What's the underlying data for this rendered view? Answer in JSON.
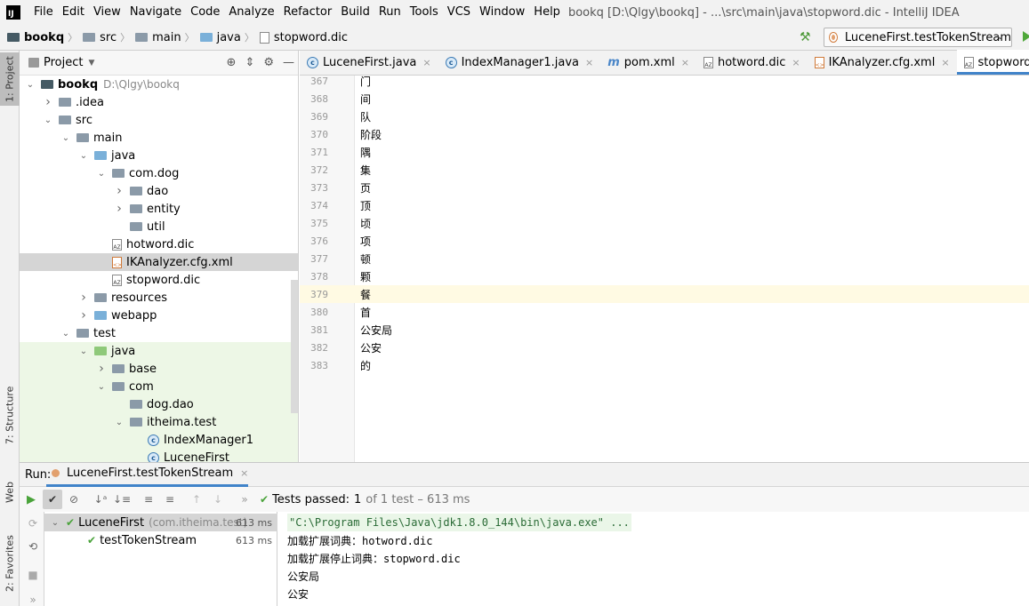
{
  "menubar": {
    "logo_text": "IJ",
    "items": [
      "File",
      "Edit",
      "View",
      "Navigate",
      "Code",
      "Analyze",
      "Refactor",
      "Build",
      "Run",
      "Tools",
      "VCS",
      "Window",
      "Help"
    ],
    "title": "bookq [D:\\Qlgy\\bookq] - ...\\src\\main\\java\\stopword.dic - IntelliJ IDEA"
  },
  "breadcrumb": [
    "bookq",
    "src",
    "main",
    "java",
    "stopword.dic"
  ],
  "run_config": {
    "label": "LuceneFirst.testTokenStream",
    "chevron": "⌄"
  },
  "left_strip": {
    "project": "1: Project",
    "structure": "7: Structure",
    "web": "Web",
    "favorites": "2: Favorites"
  },
  "project_panel": {
    "title": "Project",
    "tree": [
      {
        "label": "bookq",
        "path": "D:\\Qlgy\\bookq",
        "depth": 0,
        "open": true,
        "kind": "folder-dark"
      },
      {
        "label": ".idea",
        "depth": 1,
        "open": false,
        "kind": "folder"
      },
      {
        "label": "src",
        "depth": 1,
        "open": true,
        "kind": "folder"
      },
      {
        "label": "main",
        "depth": 2,
        "open": true,
        "kind": "folder"
      },
      {
        "label": "java",
        "depth": 3,
        "open": true,
        "kind": "folder-blue"
      },
      {
        "label": "com.dog",
        "depth": 4,
        "open": true,
        "kind": "folder"
      },
      {
        "label": "dao",
        "depth": 5,
        "open": false,
        "kind": "folder"
      },
      {
        "label": "entity",
        "depth": 5,
        "open": false,
        "kind": "folder"
      },
      {
        "label": "util",
        "depth": 5,
        "open": null,
        "kind": "folder"
      },
      {
        "label": "hotword.dic",
        "depth": 4,
        "open": null,
        "kind": "file"
      },
      {
        "label": "IKAnalyzer.cfg.xml",
        "depth": 4,
        "open": null,
        "kind": "xml",
        "selected": true
      },
      {
        "label": "stopword.dic",
        "depth": 4,
        "open": null,
        "kind": "file"
      },
      {
        "label": "resources",
        "depth": 3,
        "open": false,
        "kind": "folder"
      },
      {
        "label": "webapp",
        "depth": 3,
        "open": false,
        "kind": "folder-blue"
      },
      {
        "label": "test",
        "depth": 2,
        "open": true,
        "kind": "folder"
      },
      {
        "label": "java",
        "depth": 3,
        "open": true,
        "kind": "folder-green",
        "green": true
      },
      {
        "label": "base",
        "depth": 4,
        "open": false,
        "kind": "folder",
        "green": true
      },
      {
        "label": "com",
        "depth": 4,
        "open": true,
        "kind": "folder",
        "green": true
      },
      {
        "label": "dog.dao",
        "depth": 5,
        "open": null,
        "kind": "folder",
        "green": true
      },
      {
        "label": "itheima.test",
        "depth": 5,
        "open": true,
        "kind": "folder",
        "green": true
      },
      {
        "label": "IndexManager1",
        "depth": 6,
        "open": null,
        "kind": "class",
        "green": true
      },
      {
        "label": "LuceneFirst",
        "depth": 6,
        "open": null,
        "kind": "class",
        "green": true
      }
    ]
  },
  "tabs": [
    {
      "label": "LuceneFirst.java",
      "kind": "class",
      "close": "×"
    },
    {
      "label": "IndexManager1.java",
      "kind": "class",
      "close": "×"
    },
    {
      "label": "pom.xml",
      "kind": "maven",
      "close": "×"
    },
    {
      "label": "hotword.dic",
      "kind": "file",
      "close": "×"
    },
    {
      "label": "IKAnalyzer.cfg.xml",
      "kind": "xml",
      "close": "×"
    },
    {
      "label": "stopword.dic",
      "kind": "file",
      "close": "×",
      "active": true
    }
  ],
  "editor": {
    "lines": [
      {
        "n": "367",
        "t": "门"
      },
      {
        "n": "368",
        "t": "间"
      },
      {
        "n": "369",
        "t": "队"
      },
      {
        "n": "370",
        "t": "阶段"
      },
      {
        "n": "371",
        "t": "隅"
      },
      {
        "n": "372",
        "t": "集"
      },
      {
        "n": "373",
        "t": "页"
      },
      {
        "n": "374",
        "t": "顶"
      },
      {
        "n": "375",
        "t": "顷"
      },
      {
        "n": "376",
        "t": "项"
      },
      {
        "n": "377",
        "t": "顿"
      },
      {
        "n": "378",
        "t": "颗"
      },
      {
        "n": "379",
        "t": "餐",
        "current": true
      },
      {
        "n": "380",
        "t": "首"
      },
      {
        "n": "381",
        "t": "公安局"
      },
      {
        "n": "382",
        "t": "公安"
      },
      {
        "n": "383",
        "t": "的"
      }
    ]
  },
  "run": {
    "label": "Run:",
    "tab": "LuceneFirst.testTokenStream",
    "status_prefix": "Tests passed:",
    "status_count": "1",
    "status_rest": "of 1 test – 613 ms",
    "tests": [
      {
        "name": "LuceneFirst",
        "pkg": "(com.itheima.test)",
        "ms": "613 ms"
      },
      {
        "name": "testTokenStream",
        "ms": "613 ms"
      }
    ],
    "console": [
      "\"C:\\Program Files\\Java\\jdk1.8.0_144\\bin\\java.exe\" ...",
      "加载扩展词典：hotword.dic",
      "加载扩展停止词典：stopword.dic",
      "公安局",
      "公安"
    ]
  }
}
